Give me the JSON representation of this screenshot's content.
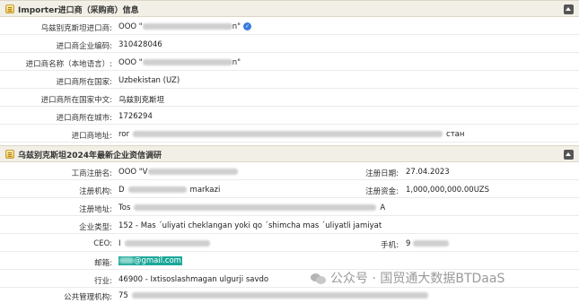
{
  "importer_section": {
    "title": "Importer进口商（采购商）信息",
    "rows": [
      {
        "label": "乌兹别克斯坦进口商:",
        "value": "OOO \"",
        "tail": "n\"",
        "badge": "✓"
      },
      {
        "label": "进口商企业编码:",
        "value": "310428046"
      },
      {
        "label": "进口商名称（本地语言）:",
        "value": "OOO \"",
        "tail": "n\""
      },
      {
        "label": "进口商所在国家:",
        "value": "Uzbekistan (UZ)"
      },
      {
        "label": "进口商所在国家中文:",
        "value": "乌兹别克斯坦"
      },
      {
        "label": "进口商所在城市:",
        "value": "1726294"
      },
      {
        "label": "进口商地址:",
        "value": "ror",
        "tail": "стан"
      }
    ]
  },
  "research_section": {
    "title": "乌兹别克斯坦2024年最新企业资信调研",
    "rows": [
      {
        "label": "工商注册名:",
        "value": "OOO \"V",
        "right_label": "注册日期:",
        "right_value": "27.04.2023"
      },
      {
        "label": "注册机构:",
        "value": "D",
        "tail": "markazi",
        "right_label": "注册资金:",
        "right_value": "1,000,000,000.00UZS"
      },
      {
        "label": "注册地址:",
        "value": "Tos",
        "tail": "A"
      },
      {
        "label": "企业类型:",
        "value": "152 - Mas ´uliyati cheklangan yoki qo ´shimcha mas ´uliyatli jamiyat"
      },
      {
        "label": "CEO:",
        "value": "I",
        "right_label": "手机:",
        "right_value": "9"
      },
      {
        "label": "邮箱:",
        "email": "@gmail.com"
      },
      {
        "label": "行业:",
        "value": "46900 - Ixtisoslashmagan ulgurji savdo"
      },
      {
        "label": "公共管理机构:",
        "value": "75"
      }
    ]
  },
  "watermark": "公众号 · 国贸通大数据BTDaaS"
}
